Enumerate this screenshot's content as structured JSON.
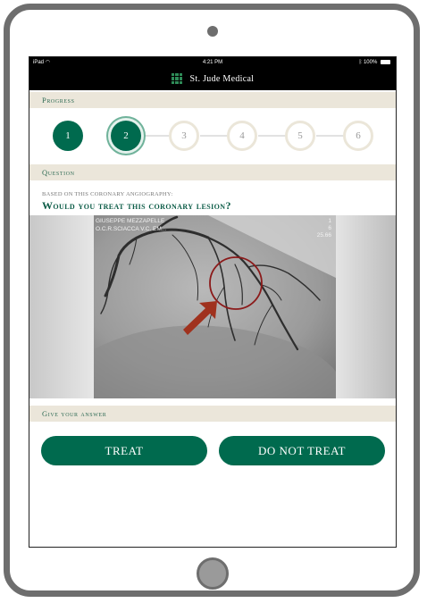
{
  "status_bar": {
    "carrier": "iPad",
    "time": "4:21 PM",
    "battery": "100%"
  },
  "brand": {
    "name": "St. Jude Medical"
  },
  "progress": {
    "header": "Progress",
    "steps": [
      {
        "label": "1",
        "state": "done"
      },
      {
        "label": "2",
        "state": "current"
      },
      {
        "label": "3",
        "state": "future"
      },
      {
        "label": "4",
        "state": "future"
      },
      {
        "label": "5",
        "state": "future"
      },
      {
        "label": "6",
        "state": "future"
      }
    ]
  },
  "question": {
    "header": "Question",
    "subtitle": "Based on this coronary angiography:",
    "title": "Would you treat this coronary lesion?",
    "image": {
      "overlay_left_line1": "GIUSEPPE MEZZAPELLE",
      "overlay_left_line2": "O.C.R.SCIACCA V.C. EM...",
      "overlay_right_line1": "1",
      "overlay_right_line2": "6",
      "overlay_right_line3": "25.66"
    }
  },
  "answer": {
    "header": "Give your answer",
    "treat_label": "TREAT",
    "do_not_treat_label": "DO NOT TREAT"
  },
  "colors": {
    "accent": "#006a4e",
    "section_band": "#ebe6da",
    "highlight_circle": "#8b1a1a",
    "arrow": "#a0321e"
  }
}
